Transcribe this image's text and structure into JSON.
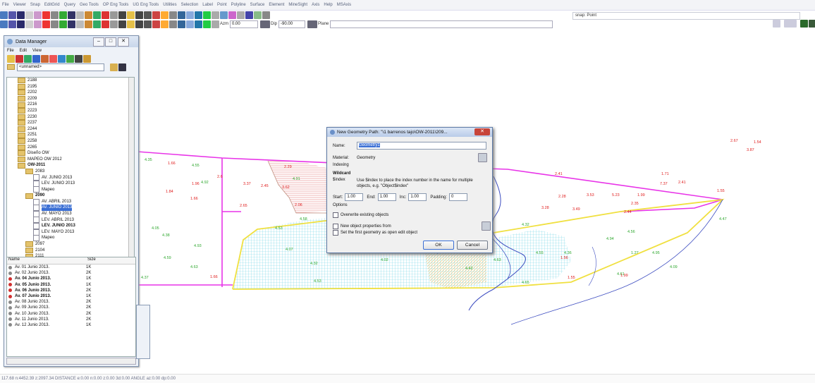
{
  "menu": [
    "File",
    "Viewer",
    "Snap",
    "EditGrid",
    "Query",
    "Geo Tools",
    "OP Eng Tools",
    "UG Eng Tools",
    "Utilities",
    "Selection",
    "Label",
    "Point",
    "Polyline",
    "Surface",
    "Element",
    "MineSight",
    "Axis",
    "Help",
    "MSAxis"
  ],
  "snap": "snap: Point",
  "toolbar2": {
    "azm_label": "Azm",
    "azm": "0.00",
    "dip_label": "Dip",
    "dip": "-90.00",
    "plane_label": "Plane"
  },
  "colors": {
    "magenta": "#e834e8",
    "yellow": "#f0e040",
    "blue": "#3c4cc0",
    "cyan_hatch": "#6fd6e6",
    "red_hatch": "#e07070",
    "orange_hatch": "#f0c060",
    "green_text": "#30a830",
    "red_text": "#e02020"
  },
  "data_manager": {
    "title": "Data Manager",
    "menu": [
      "File",
      "Edit",
      "View"
    ],
    "name_field": "<unnamed>",
    "tree": [
      {
        "label": "2188",
        "indent": 1,
        "type": "folder"
      },
      {
        "label": "2195",
        "indent": 1,
        "type": "folder"
      },
      {
        "label": "2202",
        "indent": 1,
        "type": "folder"
      },
      {
        "label": "2209",
        "indent": 1,
        "type": "folder"
      },
      {
        "label": "2216",
        "indent": 1,
        "type": "folder"
      },
      {
        "label": "2223",
        "indent": 1,
        "type": "folder"
      },
      {
        "label": "2230",
        "indent": 1,
        "type": "folder"
      },
      {
        "label": "2237",
        "indent": 1,
        "type": "folder"
      },
      {
        "label": "2244",
        "indent": 1,
        "type": "folder"
      },
      {
        "label": "2251",
        "indent": 1,
        "type": "folder"
      },
      {
        "label": "2258",
        "indent": 1,
        "type": "folder"
      },
      {
        "label": "2265",
        "indent": 1,
        "type": "folder"
      },
      {
        "label": "Diseño OW",
        "indent": 1,
        "type": "folder"
      },
      {
        "label": "MAPEO OW 2012",
        "indent": 1,
        "type": "folder"
      },
      {
        "label": "OW-2011",
        "indent": 1,
        "type": "folder",
        "bold": true
      },
      {
        "label": "2083",
        "indent": 2,
        "type": "folder"
      },
      {
        "label": "AV. JUNIO 2013",
        "indent": 3,
        "type": "file"
      },
      {
        "label": "LEV. JUNIO 2013",
        "indent": 3,
        "type": "file"
      },
      {
        "label": "Mapeo",
        "indent": 3,
        "type": "file"
      },
      {
        "label": "2090",
        "indent": 2,
        "type": "folder",
        "bold": true
      },
      {
        "label": "AV. ABRIL 2013",
        "indent": 3,
        "type": "file"
      },
      {
        "label": "AV. JUNIO 2013",
        "indent": 3,
        "type": "file",
        "selected": true
      },
      {
        "label": "AV. MAYO 2013",
        "indent": 3,
        "type": "file"
      },
      {
        "label": "LEV. ABRIL 2013",
        "indent": 3,
        "type": "file"
      },
      {
        "label": "LEV. JUNIO 2013",
        "indent": 3,
        "type": "file",
        "bold": true
      },
      {
        "label": "LEV. MAYO 2013",
        "indent": 3,
        "type": "file"
      },
      {
        "label": "Mapeo",
        "indent": 3,
        "type": "file"
      },
      {
        "label": "2097",
        "indent": 2,
        "type": "folder"
      },
      {
        "label": "2104",
        "indent": 2,
        "type": "folder"
      },
      {
        "label": "2111",
        "indent": 2,
        "type": "folder"
      }
    ],
    "list_headers": [
      "Name",
      "Size"
    ],
    "list": [
      {
        "name": "Av. 01 Junio 2013.",
        "size": "1K",
        "bold": false,
        "pin": "#888888"
      },
      {
        "name": "Av. 02 Junio 2013.",
        "size": "2K",
        "bold": false,
        "pin": "#888888"
      },
      {
        "name": "Av. 04 Junio 2013.",
        "size": "1K",
        "bold": true,
        "pin": "#d03030"
      },
      {
        "name": "Av. 05 Junio 2013.",
        "size": "1K",
        "bold": true,
        "pin": "#d03030"
      },
      {
        "name": "Av. 06 Junio 2013.",
        "size": "2K",
        "bold": true,
        "pin": "#d03030"
      },
      {
        "name": "Av. 07 Junio 2013.",
        "size": "1K",
        "bold": true,
        "pin": "#d03030"
      },
      {
        "name": "Av. 08 Junio 2013.",
        "size": "2K",
        "bold": false,
        "pin": "#888888"
      },
      {
        "name": "Av. 09 Junio 2013.",
        "size": "2K",
        "bold": false,
        "pin": "#888888"
      },
      {
        "name": "Av. 10 Junio 2013.",
        "size": "2K",
        "bold": false,
        "pin": "#888888"
      },
      {
        "name": "Av. 11 Junio 2013.",
        "size": "2K",
        "bold": false,
        "pin": "#888888"
      },
      {
        "name": "Av. 12 Junio 2013.",
        "size": "1K",
        "bold": false,
        "pin": "#888888"
      }
    ]
  },
  "dialog": {
    "title": "New Geometry  Path: \"\\1 barrenos tajo\\OW-2011\\209...",
    "name_label": "Name:",
    "name_value": "Geometry1",
    "material_label": "Material:",
    "material_value": "Geometry",
    "indexing": "Indexing",
    "wildcard": "Wildcard",
    "index_token": "$index",
    "index_desc": "Use $index to place the index number in the name for multiple objects, e.g. \"Object$index\"",
    "start_label": "Start:",
    "start": "1.00",
    "end_label": "End:",
    "end": "1.00",
    "inc_label": "Inc:",
    "inc": "1.00",
    "padding_label": "Padding:",
    "padding": "0",
    "options": "Options",
    "overwrite": "Overwrite existing objects",
    "newprops": "New object properties from",
    "setfirst": "Set the first geometry as open edit object",
    "ok": "OK",
    "cancel": "Cancel"
  },
  "labels_green": [
    "4.35",
    "4.55",
    "4.92",
    "4.05",
    "4.38",
    "4.93",
    "4.59",
    "4.37",
    "4.63",
    "4.91",
    "4.58",
    "4.53",
    "4.07",
    "4.32",
    "4.53",
    "4.02",
    "4.42",
    "4.63",
    "4.32",
    "4.55",
    "4.65",
    "4.36",
    "4.94",
    "4.56",
    "1.27",
    "4.95",
    "4.09",
    "4.61",
    "4.47"
  ],
  "labels_red": [
    "1.66",
    "2.29",
    "1.96",
    "3.37",
    "2.45",
    "3.62",
    "1.84",
    "1.66",
    "2.6",
    "2.65",
    "2.06",
    "1.66",
    "2.41",
    "2.28",
    "3.53",
    "5.23",
    "1.99",
    "1.71",
    "7.37",
    "2.41",
    "1.55",
    "2.35",
    "3.28",
    "3.49",
    "2.44",
    "1.56",
    "1.55",
    "1.99",
    "1.54",
    "2.67",
    "3.87"
  ],
  "status": "117.68  n:4452.39  z:2097.34   DISTANCE  e:0.00  n:0.00  z:0.00  3d:0.00   ANGLE  az:0.00  dp:0.00"
}
